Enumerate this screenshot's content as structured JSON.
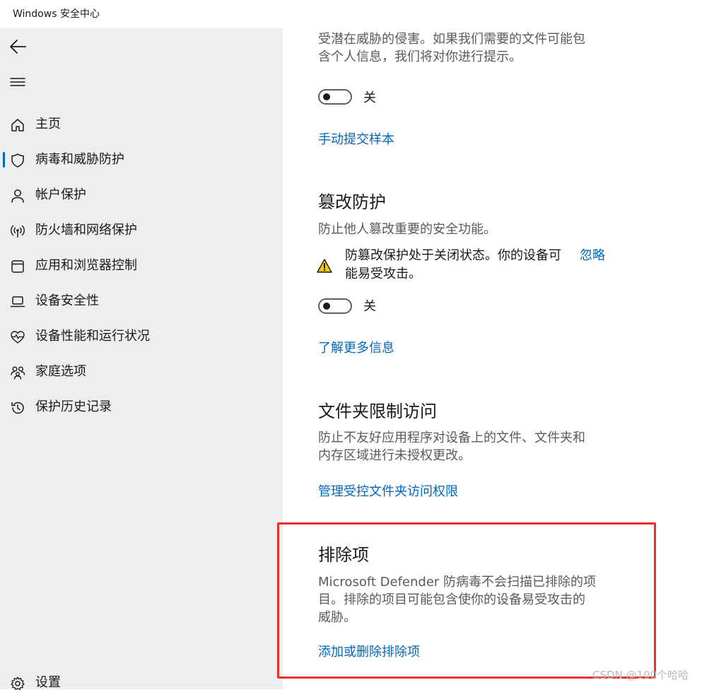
{
  "window": {
    "title": "Windows 安全中心"
  },
  "sidebar": {
    "back_icon": "back-arrow-icon",
    "menu_icon": "hamburger-menu-icon",
    "items": [
      {
        "label": "主页",
        "icon": "home-icon"
      },
      {
        "label": "病毒和威胁防护",
        "icon": "shield-icon",
        "active": true
      },
      {
        "label": "帐户保护",
        "icon": "person-icon"
      },
      {
        "label": "防火墙和网络保护",
        "icon": "wifi-antenna-icon"
      },
      {
        "label": "应用和浏览器控制",
        "icon": "app-window-icon"
      },
      {
        "label": "设备安全性",
        "icon": "laptop-icon"
      },
      {
        "label": "设备性能和运行状况",
        "icon": "heart-pulse-icon"
      },
      {
        "label": "家庭选项",
        "icon": "family-icon"
      },
      {
        "label": "保护历史记录",
        "icon": "history-icon"
      }
    ],
    "settings": {
      "label": "设置",
      "icon": "gear-icon"
    }
  },
  "main": {
    "sample": {
      "desc_line1": "受潜在威胁的侵害。如果我们需要的文件可能包",
      "desc_line2": "含个人信息，我们将对你进行提示。",
      "toggle_label": "关",
      "toggle_on": false,
      "link": "手动提交样本"
    },
    "tamper": {
      "title": "篡改防护",
      "desc": "防止他人篡改重要的安全功能。",
      "warning_line1": "防篡改保护处于关闭状态。你的设备可",
      "warning_line2": "能易受攻击。",
      "dismiss": "忽略",
      "toggle_label": "关",
      "toggle_on": false,
      "link": "了解更多信息"
    },
    "folder": {
      "title": "文件夹限制访问",
      "desc_line1": "防止不友好应用程序对设备上的文件、文件夹和",
      "desc_line2": "内存区域进行未授权更改。",
      "link": "管理受控文件夹访问权限"
    },
    "exclusions": {
      "title": "排除项",
      "desc_line1": "Microsoft Defender 防病毒不会扫描已排除的项",
      "desc_line2": "目。排除的项目可能包含使你的设备易受攻击的",
      "desc_line3": "威胁。",
      "link": "添加或删除排除项"
    }
  },
  "watermark": "CSDN @100个哈哈",
  "colors": {
    "accent": "#0067c0",
    "highlight": "#e8302c",
    "warning": "#f2c811",
    "sidebar_bg": "#eeeeee"
  }
}
